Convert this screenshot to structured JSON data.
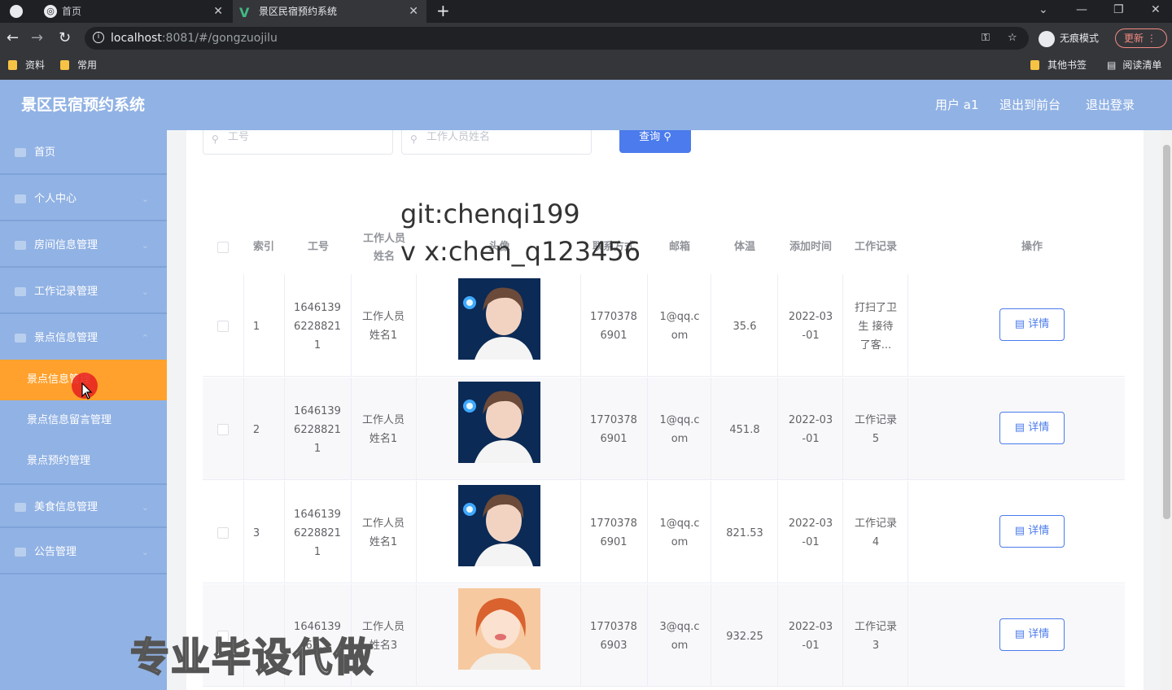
{
  "browser": {
    "tabs": [
      {
        "title": "首页"
      },
      {
        "title": "景区民宿预约系统"
      }
    ],
    "url_host": "localhost",
    "url_rest": ":8081/#/gongzuojilu",
    "incognito_label": "无痕模式",
    "update_label": "更新",
    "bookmarks_left": [
      "资料",
      "常用"
    ],
    "bookmarks_right": [
      "其他书签",
      "阅读清单"
    ]
  },
  "header": {
    "title": "景区民宿预约系统",
    "user": "用户 a1",
    "back_to_front": "退出到前台",
    "logout": "退出登录"
  },
  "sidebar": {
    "items": [
      {
        "label": "首页",
        "icon": "home-icon"
      },
      {
        "label": "个人中心",
        "icon": "user-icon"
      },
      {
        "label": "房间信息管理",
        "icon": "list-icon"
      },
      {
        "label": "工作记录管理",
        "icon": "folder-icon"
      },
      {
        "label": "景点信息管理",
        "icon": "flag-icon"
      }
    ],
    "subitems": [
      "景点信息管理",
      "景点信息留言管理",
      "景点预约管理"
    ],
    "items_after": [
      {
        "label": "美食信息管理",
        "icon": "food-icon"
      },
      {
        "label": "公告管理",
        "icon": "megaphone-icon"
      }
    ]
  },
  "search": {
    "job_no_placeholder": "工号",
    "name_placeholder": "工作人员姓名",
    "button": "查询"
  },
  "watermark": {
    "line1": "git:chenqi199",
    "line2": "v x:chen_q123456",
    "promo": "专业毕设代做"
  },
  "table": {
    "headers": [
      "索引",
      "工号",
      "工作人员\n姓名",
      "头像",
      "联系方式",
      "邮箱",
      "体温",
      "添加时间",
      "工作记录",
      "操作"
    ],
    "detail_label": "详情",
    "rows": [
      {
        "index": "1",
        "job_no": "1646139\n6228821\n1",
        "name": "工作人员\n姓名1",
        "phone": "1770378\n6901",
        "email": "1@qq.c\nom",
        "temp": "35.6",
        "date": "2022-03\n-01",
        "record": "打扫了卫\n生 接待\n了客...",
        "avatar": "male"
      },
      {
        "index": "2",
        "job_no": "1646139\n6228821\n1",
        "name": "工作人员\n姓名1",
        "phone": "1770378\n6901",
        "email": "1@qq.c\nom",
        "temp": "451.8",
        "date": "2022-03\n-01",
        "record": "工作记录\n5",
        "avatar": "male"
      },
      {
        "index": "3",
        "job_no": "1646139\n6228821\n1",
        "name": "工作人员\n姓名1",
        "phone": "1770378\n6901",
        "email": "1@qq.c\nom",
        "temp": "821.53",
        "date": "2022-03\n-01",
        "record": "工作记录\n4",
        "avatar": "male"
      },
      {
        "index": "",
        "job_no": "1646139\n62...",
        "name": "工作人员\n姓名3",
        "phone": "1770378\n6903",
        "email": "3@qq.c\nom",
        "temp": "932.25",
        "date": "2022-03\n-01",
        "record": "工作记录\n3",
        "avatar": "female"
      }
    ]
  },
  "colors": {
    "header_bg": "#91b2e4",
    "active_menu": "#ffa12c",
    "primary": "#4b7bec"
  }
}
